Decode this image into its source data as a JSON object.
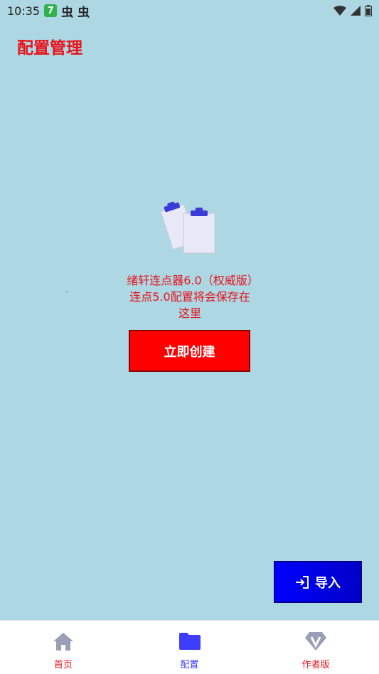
{
  "status_bar": {
    "time": "10:35",
    "badge": "7",
    "bug_icons": [
      "虫",
      "虫"
    ]
  },
  "page": {
    "title": "配置管理"
  },
  "empty_state": {
    "message": "绪轩连点器6.0（权威版）连点5.0配置将会保存在这里",
    "create_button": "立即创建"
  },
  "import_button": {
    "label": "导入"
  },
  "bottom_nav": {
    "items": [
      {
        "label": "首页",
        "icon": "home-icon"
      },
      {
        "label": "配置",
        "icon": "folder-icon",
        "active": true
      },
      {
        "label": "作者版",
        "icon": "diamond-v-icon"
      }
    ]
  },
  "colors": {
    "background": "#ADD8E3",
    "accent_red": "#E8121B",
    "button_red": "#FF0000",
    "button_blue": "#0000FF",
    "active_nav": "#3D3DFF"
  }
}
